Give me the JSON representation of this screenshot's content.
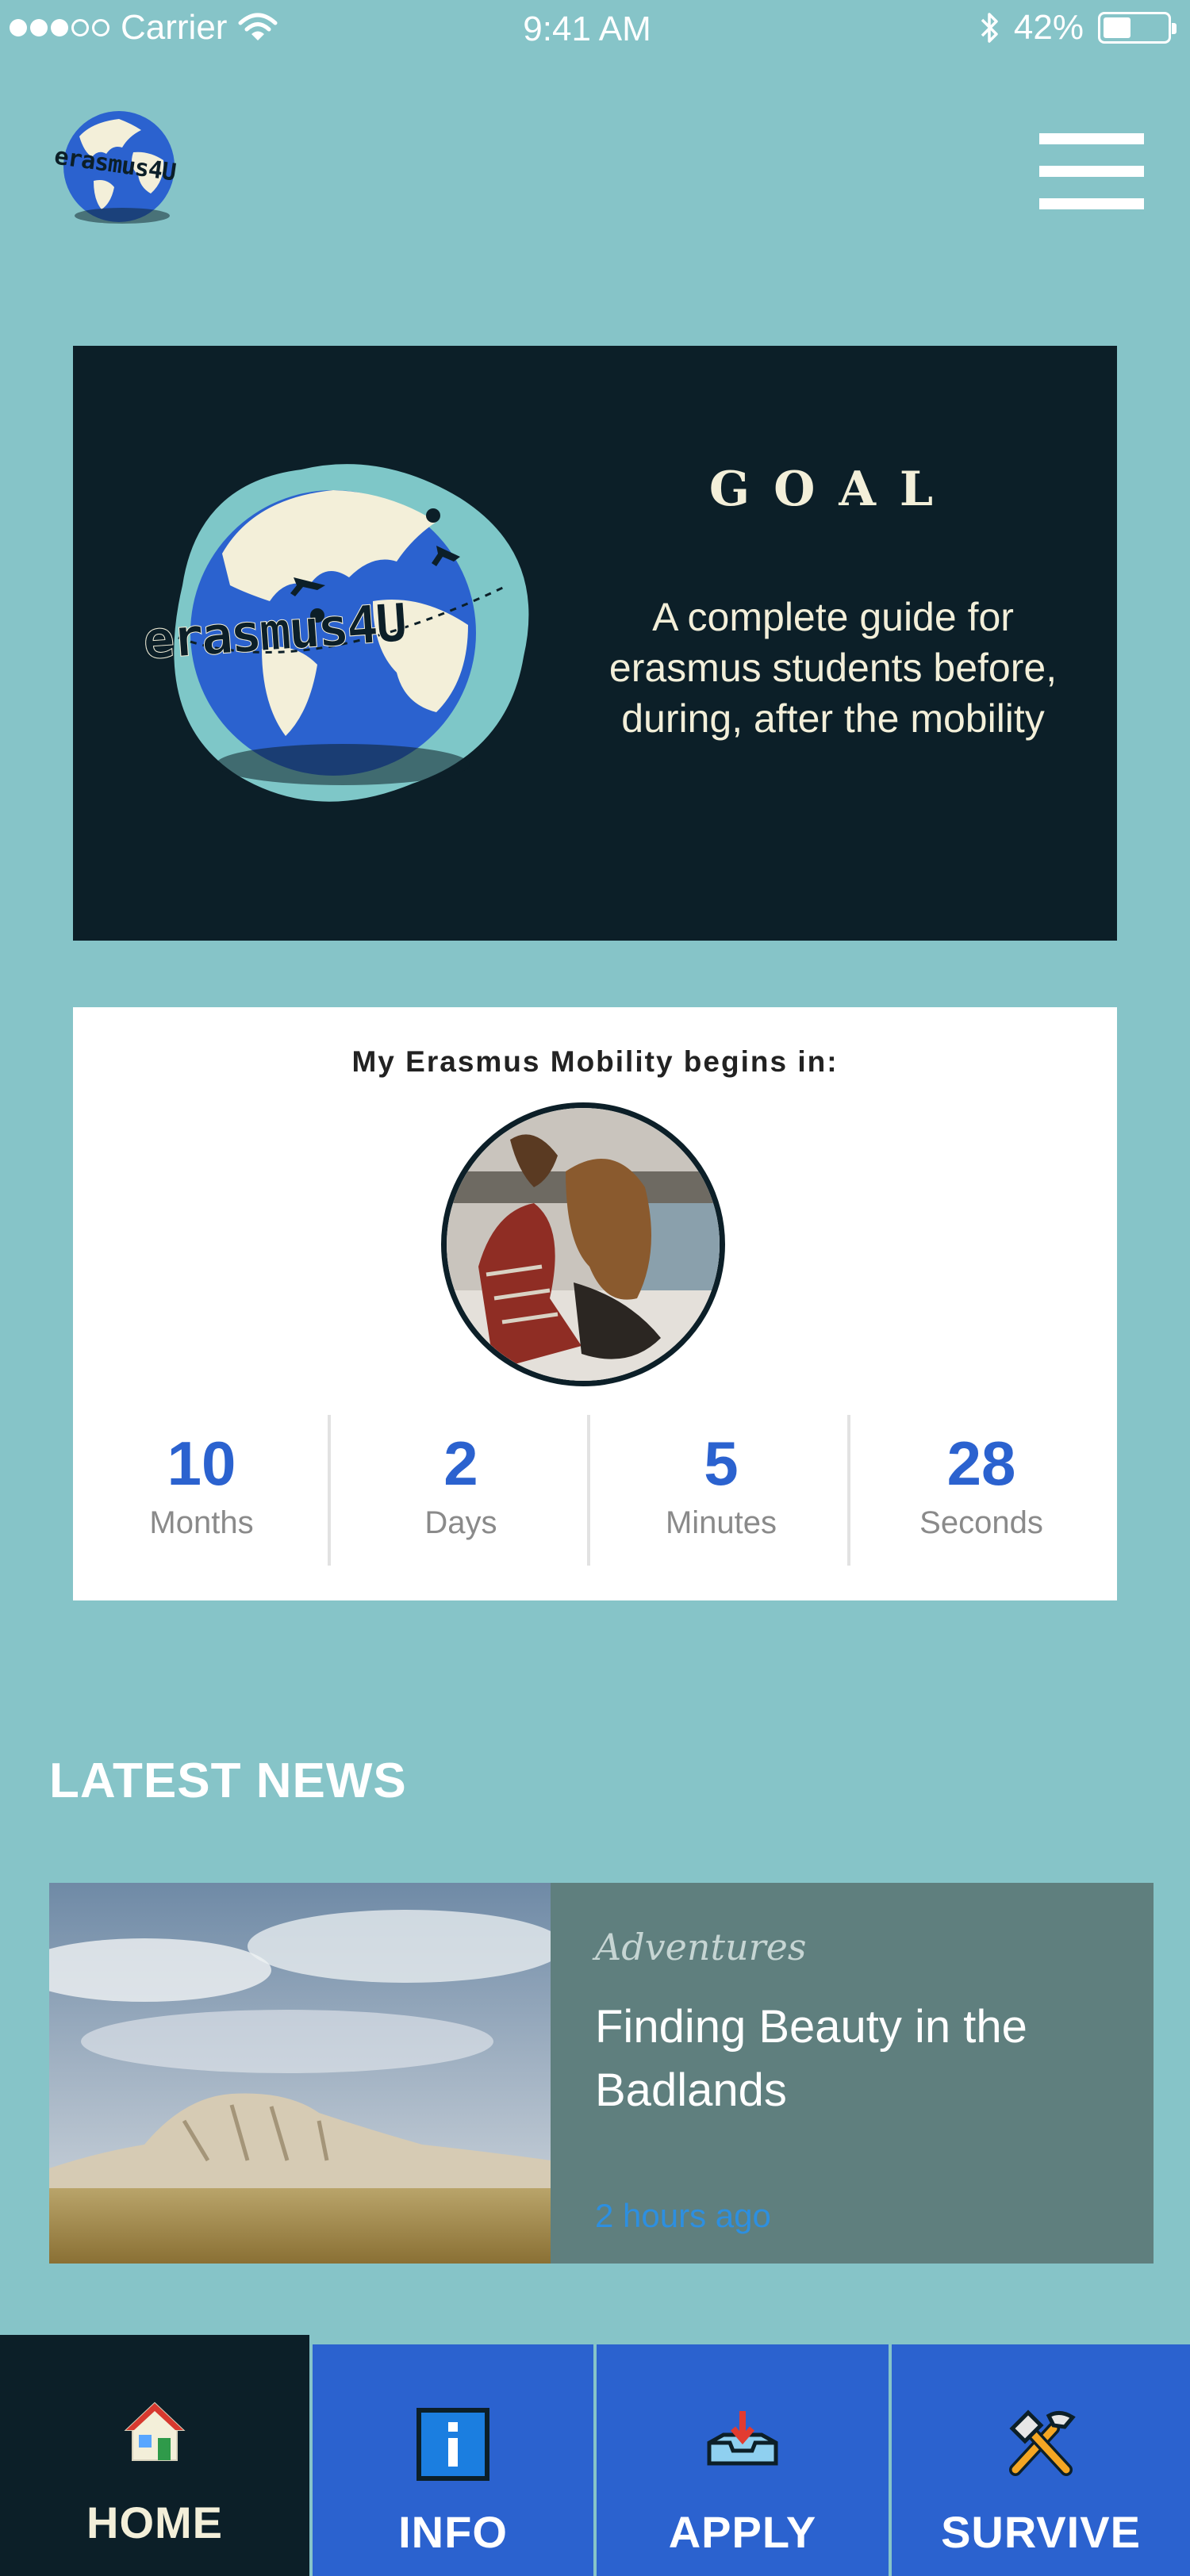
{
  "status_bar": {
    "carrier": "Carrier",
    "time": "9:41 AM",
    "battery": "42%",
    "battery_level": 0.42
  },
  "header": {
    "logo_text": "erasmus4U"
  },
  "goal": {
    "logo_text": "erasmus4U",
    "title": "GOAL",
    "description": "A complete guide for erasmus students before, during, after the mobility"
  },
  "countdown": {
    "title": "My Erasmus Mobility begins in:",
    "units": [
      {
        "value": "10",
        "label": "Months"
      },
      {
        "value": "2",
        "label": "Days"
      },
      {
        "value": "5",
        "label": "Minutes"
      },
      {
        "value": "28",
        "label": "Seconds"
      }
    ]
  },
  "news": {
    "heading": "LATEST NEWS",
    "items": [
      {
        "category": "Adventures",
        "title": "Finding Beauty in the Badlands",
        "time": "2 hours ago"
      }
    ]
  },
  "tabs": [
    {
      "label": "HOME",
      "icon": "home-icon",
      "active": true
    },
    {
      "label": "INFO",
      "icon": "info-icon",
      "active": false
    },
    {
      "label": "APPLY",
      "icon": "inbox-icon",
      "active": false
    },
    {
      "label": "SURVIVE",
      "icon": "tools-icon",
      "active": false
    }
  ],
  "colors": {
    "background": "#86c4c8",
    "dark": "#0c1f28",
    "accent": "#2b62cf",
    "cream": "#f3efd9",
    "news_panel": "#5f7f7e",
    "news_time": "#2d8fe0"
  }
}
